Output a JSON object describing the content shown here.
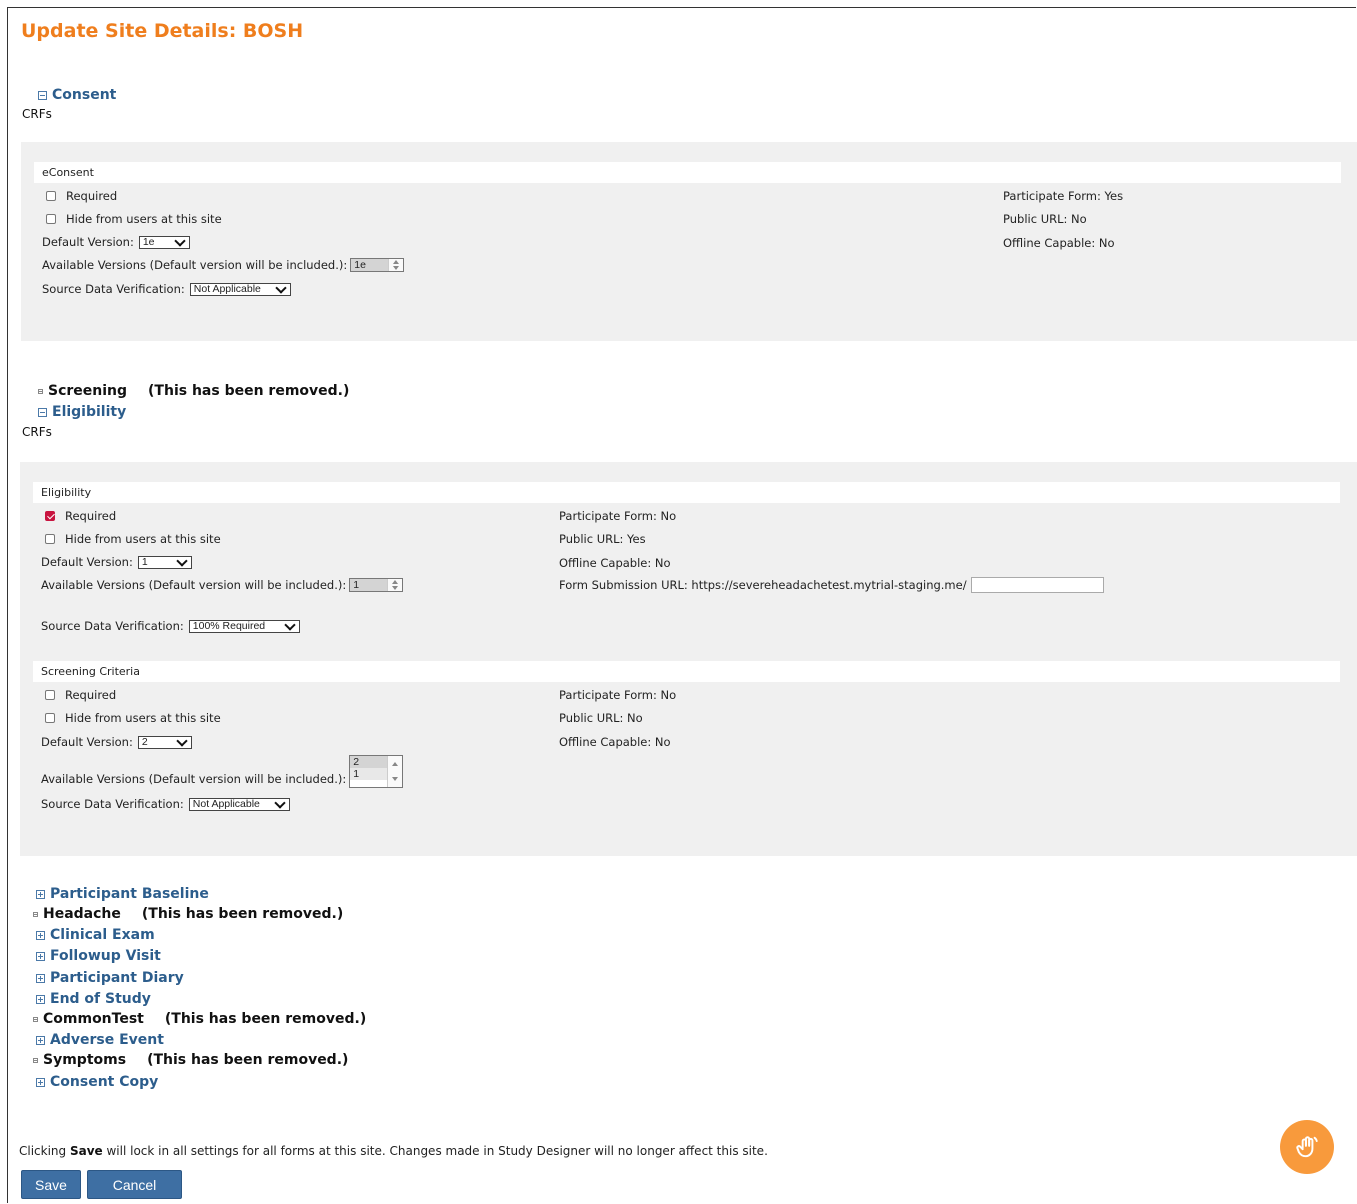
{
  "page": {
    "title": "Update Site Details: BOSH"
  },
  "sections_top": {
    "consent": {
      "label": "Consent"
    },
    "crfs_label": "CRFs",
    "screening": {
      "label": "Screening",
      "note": "(This has been removed.)"
    },
    "eligibility": {
      "label": "Eligibility"
    }
  },
  "econsent_form": {
    "title": "eConsent",
    "required_label": "Required",
    "hide_label": "Hide from users at this site",
    "default_version_label": "Default Version:",
    "default_version_value": "1e",
    "available_versions_label": "Available Versions (Default version will be included.):",
    "available_versions": [
      "1e"
    ],
    "sdv_label": "Source Data Verification:",
    "sdv_value": "Not Applicable",
    "participate_form": "Participate Form:  Yes",
    "public_url": "Public URL: No",
    "offline_capable": "Offline Capable: No"
  },
  "eligibility_form": {
    "title": "Eligibility",
    "required_label": "Required",
    "required_checked": true,
    "hide_label": "Hide from users at this site",
    "default_version_label": "Default Version:",
    "default_version_value": "1",
    "available_versions_label": "Available Versions (Default version will be included.):",
    "available_versions": [
      "1"
    ],
    "sdv_label": "Source Data Verification:",
    "sdv_value": "100% Required",
    "participate_form": "Participate Form:  No",
    "public_url": "Public URL: Yes",
    "offline_capable": "Offline Capable: No",
    "form_submission_url": "Form Submission URL: https://severeheadachetest.mytrial-staging.me/"
  },
  "screening_criteria_form": {
    "title": "Screening Criteria",
    "required_label": "Required",
    "hide_label": "Hide from users at this site",
    "default_version_label": "Default Version:",
    "default_version_value": "2",
    "available_versions_label": "Available Versions (Default version will be included.):",
    "available_versions": [
      "2",
      "1"
    ],
    "sdv_label": "Source Data Verification:",
    "sdv_value": "Not Applicable",
    "participate_form": "Participate Form:  No",
    "public_url": "Public URL: No",
    "offline_capable": "Offline Capable: No"
  },
  "sections_bottom": {
    "participant_baseline": "Participant Baseline",
    "headache": "Headache",
    "headache_note": "(This has been removed.)",
    "clinical_exam": "Clinical Exam",
    "followup_visit": "Followup Visit",
    "participant_diary": "Participant Diary",
    "end_of_study": "End of Study",
    "commontest": "CommonTest",
    "commontest_note": "(This has been removed.)",
    "adverse_event": "Adverse Event",
    "symptoms": "Symptoms",
    "symptoms_note": "(This has been removed.)",
    "consent_copy": "Consent Copy"
  },
  "footer": {
    "note_prefix": "Clicking ",
    "note_bold": "Save",
    "note_suffix": " will lock in all settings for all forms at this site. Changes made in Study Designer will no longer affect this site.",
    "save_label": "Save",
    "cancel_label": "Cancel"
  },
  "colors": {
    "title_orange": "#ef7e1d",
    "link_blue": "#2c5d8c",
    "button_blue": "#3e6fa3",
    "fab_orange": "#f89a3c"
  }
}
